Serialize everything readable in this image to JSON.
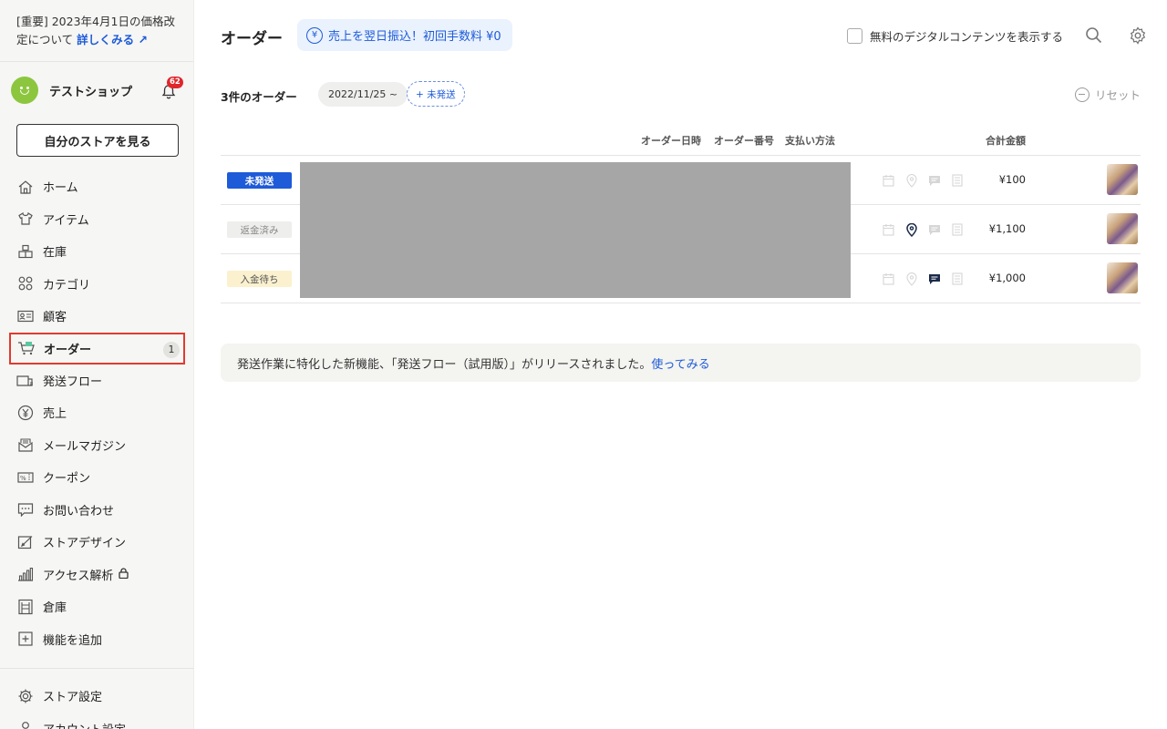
{
  "notice": {
    "text": "[重要] 2023年4月1日の価格改定について",
    "link": "詳しくみる ↗"
  },
  "shop": {
    "name": "テストショップ",
    "notifications": "62"
  },
  "sidebar": {
    "store_button": "自分のストアを見る",
    "items": [
      {
        "label": "ホーム",
        "icon": "home-icon"
      },
      {
        "label": "アイテム",
        "icon": "shirt-icon"
      },
      {
        "label": "在庫",
        "icon": "boxes-icon"
      },
      {
        "label": "カテゴリ",
        "icon": "grid-icon"
      },
      {
        "label": "顧客",
        "icon": "id-card-icon"
      },
      {
        "label": "オーダー",
        "icon": "cart-icon",
        "badge": "1"
      },
      {
        "label": "発送フロー",
        "icon": "shipping-icon"
      },
      {
        "label": "売上",
        "icon": "yen-icon"
      },
      {
        "label": "メールマガジン",
        "icon": "mail-icon"
      },
      {
        "label": "クーポン",
        "icon": "coupon-icon"
      },
      {
        "label": "お問い合わせ",
        "icon": "chat-icon"
      },
      {
        "label": "ストアデザイン",
        "icon": "design-icon"
      },
      {
        "label": "アクセス解析",
        "icon": "bar-chart-icon"
      },
      {
        "label": "倉庫",
        "icon": "warehouse-icon"
      },
      {
        "label": "機能を追加",
        "icon": "plus-box-icon"
      }
    ],
    "bottom_items": [
      {
        "label": "ストア設定",
        "icon": "gear-icon"
      },
      {
        "label": "アカウント設定",
        "icon": "user-icon"
      }
    ]
  },
  "header": {
    "title": "オーダー",
    "promo": "売上を翌日振込！初回手数料 ¥0",
    "promo_icon": "¥",
    "free_content_label": "無料のデジタルコンテンツを表示する"
  },
  "filters": {
    "count": "3件のオーダー",
    "date_chip": "2022/11/25 ~",
    "add_chip": "+ 未発送",
    "reset": "リセット"
  },
  "table": {
    "columns": {
      "date": "オーダー日時",
      "number": "オーダー番号",
      "payment": "支払い方法",
      "total": "合計金額"
    },
    "rows": [
      {
        "status": "未発送",
        "amount": "¥100"
      },
      {
        "status": "返金済み",
        "amount": "¥1,100"
      },
      {
        "status": "入金待ち",
        "amount": "¥1,000"
      }
    ]
  },
  "info": {
    "text": "発送作業に特化した新機能、「発送フロー（試用版）」がリリースされました。",
    "link": "使ってみる"
  },
  "colors": {
    "accent": "#1e5bd8",
    "active_border": "#e03a2f",
    "sidebar_bg": "#f6f6f4",
    "badge_red": "#e0262b"
  }
}
